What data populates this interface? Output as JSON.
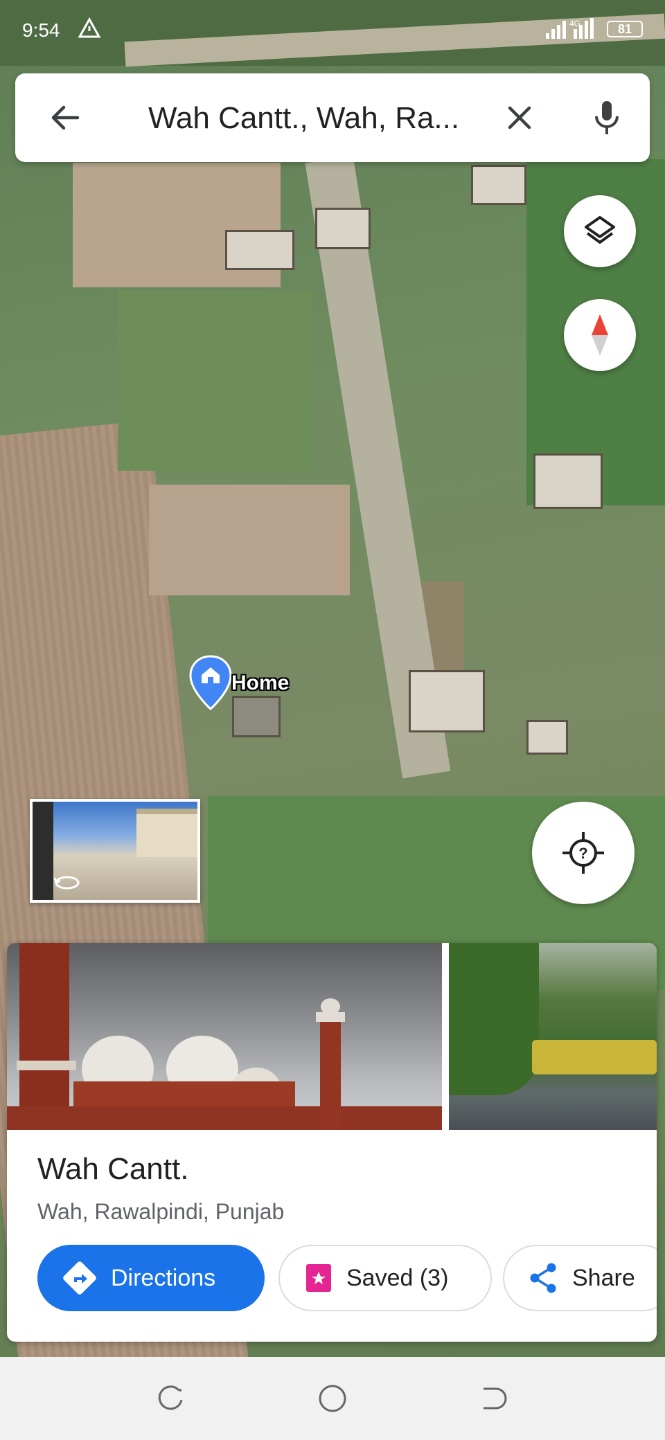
{
  "status_bar": {
    "time": "9:54",
    "network": "4G",
    "battery": "81"
  },
  "search": {
    "query": "Wah Cantt., Wah, Ra..."
  },
  "map": {
    "home_label": "Home",
    "map_type": "satellite"
  },
  "place": {
    "title": "Wah Cantt.",
    "subtitle": "Wah, Rawalpindi, Punjab"
  },
  "actions": {
    "directions": "Directions",
    "saved": "Saved (3)",
    "share": "Share"
  },
  "colors": {
    "accent": "#1a73e8",
    "saved_icon": "#e52592",
    "compass_red": "#ea4335"
  },
  "icons": {
    "back": "arrow-left-icon",
    "clear": "close-icon",
    "mic": "mic-icon",
    "layers": "layers-icon",
    "compass": "compass-icon",
    "locate": "location-unknown-icon",
    "home_pin": "home-pin-icon",
    "directions": "directions-icon",
    "saved": "bookmark-icon",
    "share": "share-icon"
  }
}
